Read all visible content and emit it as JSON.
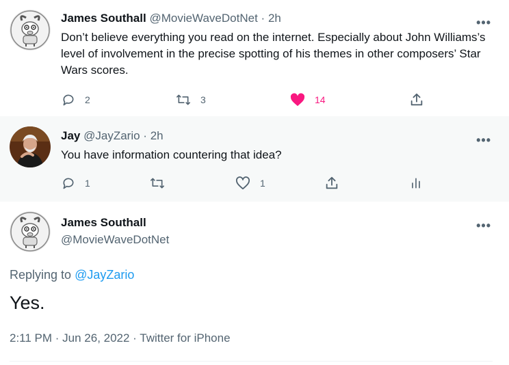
{
  "tweets": [
    {
      "display_name": "James Southall",
      "handle": "@MovieWaveDotNet",
      "separator": "·",
      "time": "2h",
      "text": "Don’t believe everything you read on the internet. Especially about John Williams’s level of involvement in the precise spotting of his themes in other composers’ Star Wars scores.",
      "replies": "2",
      "retweets": "3",
      "likes": "14",
      "liked": true
    },
    {
      "display_name": "Jay",
      "handle": "@JayZario",
      "separator": "·",
      "time": "2h",
      "text": "You have information countering that idea?",
      "replies": "1",
      "retweets": "",
      "likes": "1",
      "liked": false
    }
  ],
  "focused_tweet": {
    "display_name": "James Southall",
    "handle": "@MovieWaveDotNet",
    "replying_prefix": "Replying to ",
    "replying_to": "@JayZario",
    "text": "Yes.",
    "timestamp": "2:11 PM · Jun 26, 2022 · Twitter for iPhone"
  },
  "icons": {
    "more": "more-horizontal-icon",
    "reply": "reply-icon",
    "retweet": "retweet-icon",
    "like": "heart-icon",
    "share": "share-icon",
    "analytics": "analytics-icon"
  },
  "colors": {
    "like_active": "#f91880",
    "link": "#1d9bf0",
    "muted": "#536471",
    "thread_line": "#cfd9de",
    "hover_bg": "#f7f9f9"
  }
}
